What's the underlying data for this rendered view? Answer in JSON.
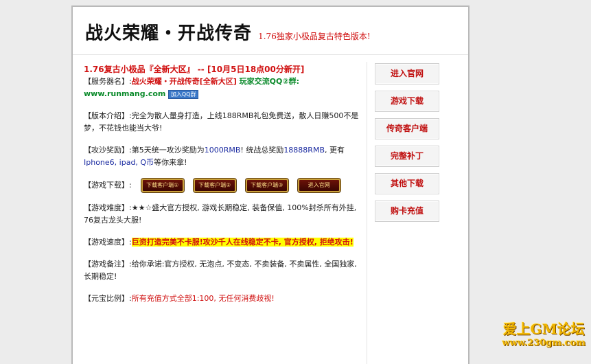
{
  "header": {
    "title": "战火荣耀・开战传奇",
    "subtitle": "1.76独家小极品复古特色版本!"
  },
  "main": {
    "headline_left": "1.76复古小极品『全新大区』",
    "headline_sep": " -- ",
    "headline_right": "[10月5日18点00分新开]",
    "server_label": "【服务器名】:",
    "server_name": "战火荣耀・开战传奇[全新大区]",
    "server_qq": " 玩家交流QQ②群:",
    "server_url": "www.runmang.com",
    "qq_button": "加入QQ群",
    "version_label": "【版本介绍】:",
    "version_text": "完全为散人量身打造，上线188RMB礼包免费送，散人日赚500不是梦，不花钱也能当大爷!",
    "siege_label": "【攻沙奖励】:",
    "siege_text1": "第5天统一攻沙奖励为",
    "siege_amount1": "1000RMB",
    "siege_text2": "! 统战总奖励",
    "siege_amount2": "18888RMB",
    "siege_text3": ", 更有",
    "siege_prizes": "Iphone6, ipad, Q币",
    "siege_text4": "等你来拿!",
    "download_label": "【游戏下载】:",
    "download_buttons": [
      "下载客户端①",
      "下载客户端②",
      "下载客户端③",
      "进入官网"
    ],
    "difficulty_label": "【游戏难度】:",
    "difficulty_text": "★★☆盛大官方授权, 游戏长期稳定, 装备保值, 100%封杀所有外挂, 76复古龙头大服!",
    "speed_label": "【游戏速度】:",
    "speed_text": "巨资打造完美不卡服!攻沙千人在线稳定不卡, 官方授权, 拒绝攻击!",
    "notes_label": "【游戏备注】:",
    "notes_text": "给你承诺:官方授权, 无泡点, 不变态, 不卖装备, 不卖属性, 全国独家, 长期稳定!",
    "ratio_label": "【元宝比例】:",
    "ratio_text": "所有充值方式全部1:100, 无任何消费歧视!"
  },
  "sidebar": {
    "items": [
      "进入官网",
      "游戏下载",
      "传奇客户端",
      "完整补丁",
      "其他下载",
      "购卡充值"
    ]
  },
  "logo": {
    "line1": "爱上GM论坛",
    "line2": "www.230gm.com"
  }
}
